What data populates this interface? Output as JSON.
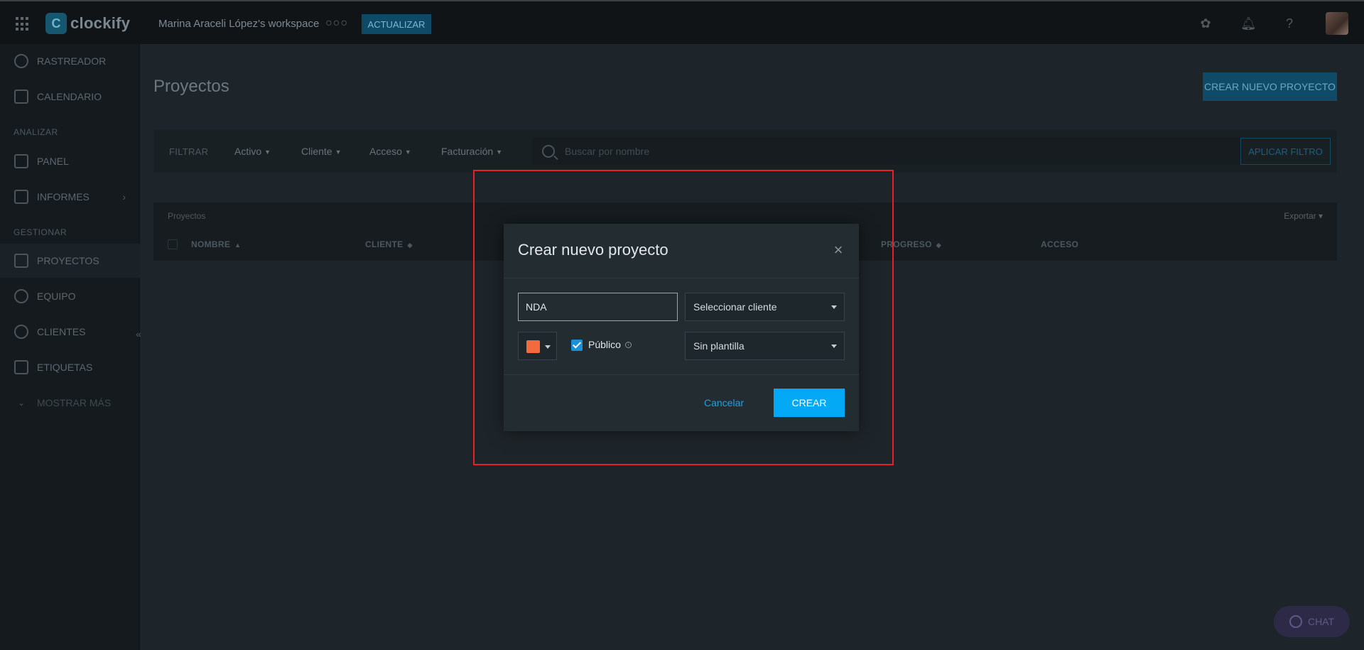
{
  "topbar": {
    "brand": "clockify",
    "workspace": "Marina Araceli López's workspace",
    "more": "○○○",
    "upgrade_label": "ACTUALIZAR"
  },
  "sidebar": {
    "items": [
      {
        "label": "RASTREADOR",
        "icon": "clock-icon"
      },
      {
        "label": "CALENDARIO",
        "icon": "calendar-icon"
      },
      {
        "label": "PANEL",
        "icon": "dashboard-icon"
      },
      {
        "label": "INFORMES",
        "icon": "bar-chart-icon"
      },
      {
        "label": "PROYECTOS",
        "icon": "document-icon"
      },
      {
        "label": "EQUIPO",
        "icon": "team-icon"
      },
      {
        "label": "CLIENTES",
        "icon": "user-icon"
      },
      {
        "label": "ETIQUETAS",
        "icon": "tag-icon"
      },
      {
        "label": "MOSTRAR MÁS",
        "icon": "chevron-down-icon"
      }
    ],
    "sections": {
      "analyze": "ANALIZAR",
      "manage": "GESTIONAR"
    },
    "collapse": "«"
  },
  "main": {
    "title": "Proyectos",
    "create_label": "CREAR NUEVO PROYECTO",
    "filter": {
      "label": "FILTRAR",
      "dropdowns": [
        "Activo",
        "Cliente",
        "Acceso",
        "Facturación"
      ],
      "search_placeholder": "Buscar por nombre",
      "apply_label": "APLICAR FILTRO"
    },
    "table": {
      "caption": "Proyectos",
      "export": "Exportar ▾",
      "columns": [
        "NOMBRE",
        "CLIENTE",
        "PROGRESO",
        "ACCESO"
      ]
    }
  },
  "chat": {
    "label": "CHAT"
  },
  "modal": {
    "title": "Crear nuevo proyecto",
    "close": "×",
    "name_value": "NDA",
    "client_select": "Seleccionar cliente",
    "color": "#f26a3d",
    "public_label": "Público",
    "public_checked": true,
    "template_select": "Sin plantilla",
    "cancel_label": "Cancelar",
    "create_label": "CREAR"
  }
}
